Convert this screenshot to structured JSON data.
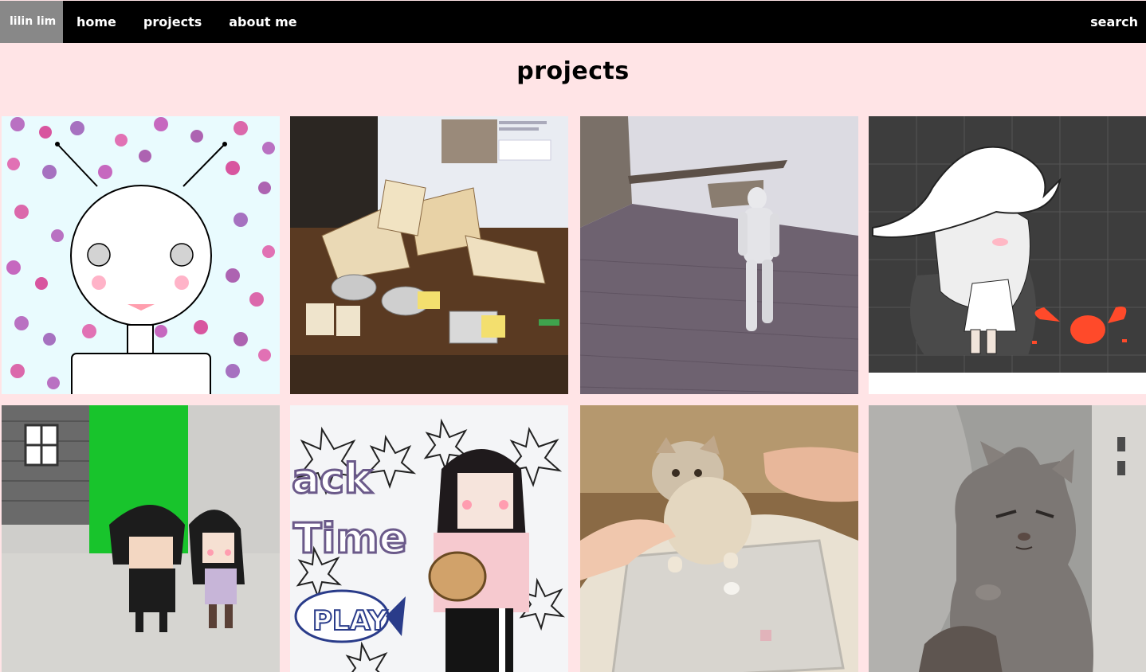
{
  "nav": {
    "brand": "lilin lim",
    "items": [
      "home",
      "projects",
      "about me"
    ],
    "search": "search"
  },
  "page": {
    "title": "projects"
  },
  "projects": [
    {
      "icon": "robot-face-dots-image"
    },
    {
      "icon": "paper-craft-prototype-image"
    },
    {
      "icon": "3d-mannequin-rooftop-image"
    },
    {
      "icon": "anime-girl-hat-crab-image"
    },
    {
      "icon": "pixel-couple-house-image"
    },
    {
      "icon": "pixel-girl-snack-time-image"
    },
    {
      "icon": "cat-on-scale-image"
    },
    {
      "icon": "grumpy-cat-image"
    }
  ],
  "colors": {
    "nav_bg": "#000000",
    "brand_bg": "#888888",
    "page_bg": "#ffe4e6"
  }
}
